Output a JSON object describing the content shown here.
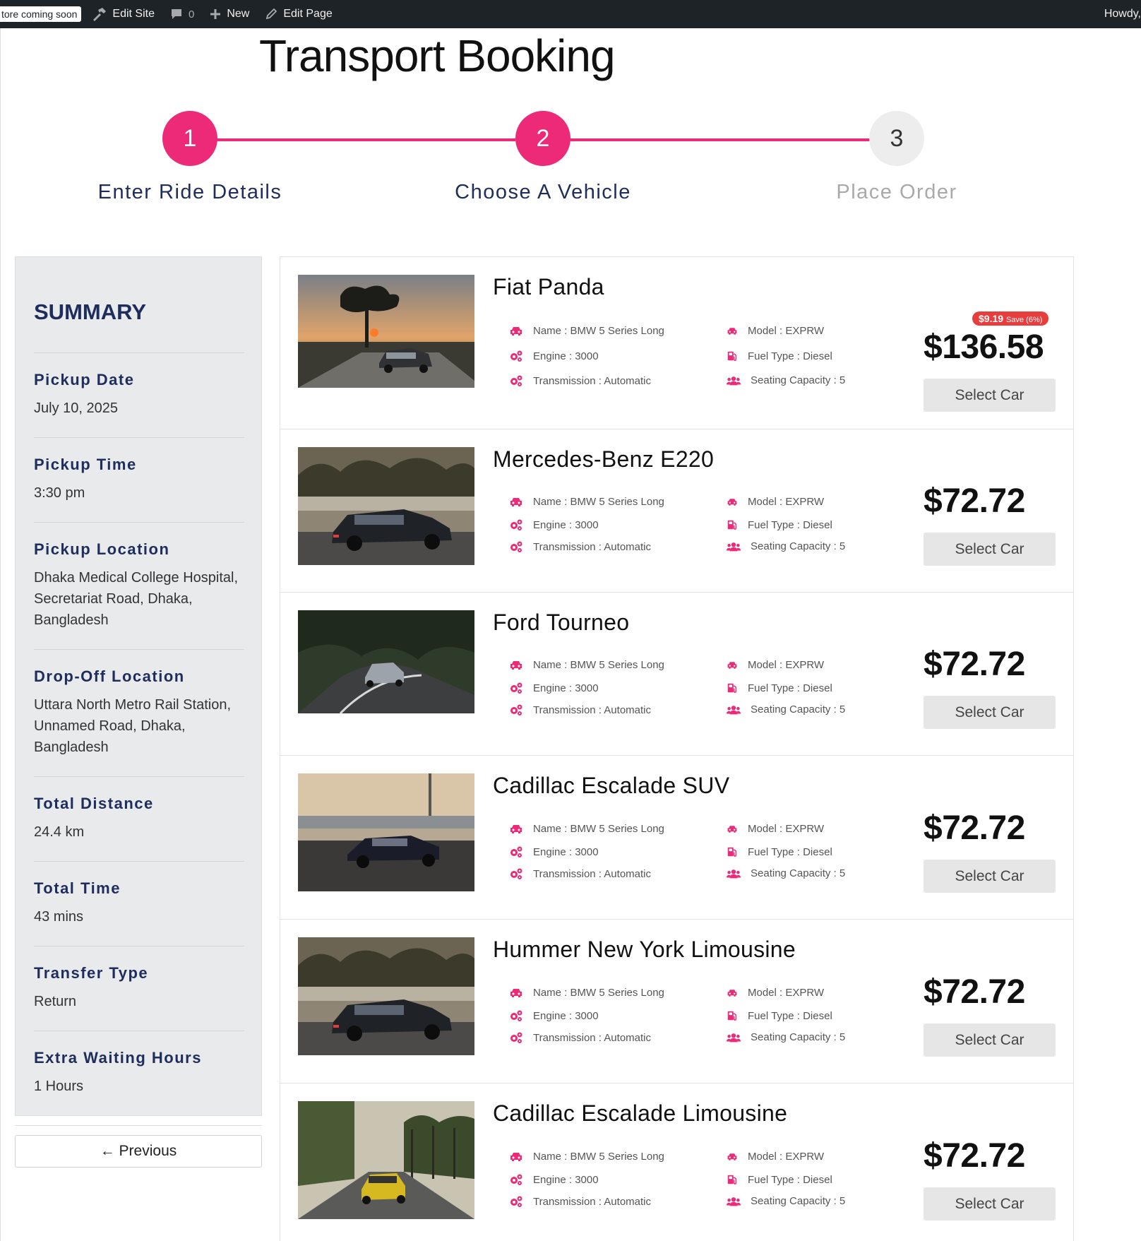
{
  "admin_bar": {
    "badge": "tore coming soon",
    "edit_site": "Edit Site",
    "comments_count": "0",
    "new": "New",
    "edit_page": "Edit Page",
    "howdy": "Howdy,"
  },
  "page": {
    "title": "Transport Booking"
  },
  "colors": {
    "accent": "#ec2a77",
    "navy": "#1e2d5c",
    "sale": "#e73d3d"
  },
  "steps": [
    {
      "number": "1",
      "label": "Enter Ride Details",
      "state": "active"
    },
    {
      "number": "2",
      "label": "Choose A Vehicle",
      "state": "active"
    },
    {
      "number": "3",
      "label": "Place Order",
      "state": "inactive"
    }
  ],
  "summary": {
    "title": "SUMMARY",
    "items": [
      {
        "label": "Pickup Date",
        "value": "July 10, 2025"
      },
      {
        "label": "Pickup Time",
        "value": "3:30 pm"
      },
      {
        "label": "Pickup Location",
        "value": "Dhaka Medical College Hospital, Secretariat Road, Dhaka, Bangladesh"
      },
      {
        "label": "Drop-Off Location",
        "value": "Uttara North Metro Rail Station, Unnamed Road, Dhaka, Bangladesh"
      },
      {
        "label": "Total Distance",
        "value": "24.4 km"
      },
      {
        "label": "Total Time",
        "value": "43 mins"
      },
      {
        "label": "Transfer Type",
        "value": "Return"
      },
      {
        "label": "Extra Waiting Hours",
        "value": "1 Hours"
      }
    ]
  },
  "previous_button": "← Previous",
  "vehicles": [
    {
      "name": "Fiat Panda",
      "price": "$136.58",
      "save_amount": "$9.19",
      "save_text": "Save (6%)",
      "specs_left": [
        "Name : BMW 5 Series Long",
        "Engine : 3000",
        "Transmission : Automatic"
      ],
      "specs_right": [
        "Model : EXPRW",
        "Fuel Type : Diesel",
        "Seating Capacity : 5"
      ],
      "button": "Select Car",
      "image": "sunset-tree-sedan"
    },
    {
      "name": "Mercedes-Benz E220",
      "price": "$72.72",
      "specs_left": [
        "Name : BMW 5 Series Long",
        "Engine : 3000",
        "Transmission : Automatic"
      ],
      "specs_right": [
        "Model : EXPRW",
        "Fuel Type : Diesel",
        "Seating Capacity : 5"
      ],
      "button": "Select Car",
      "image": "blurred-hatchback"
    },
    {
      "name": "Ford Tourneo",
      "price": "$72.72",
      "specs_left": [
        "Name : BMW 5 Series Long",
        "Engine : 3000",
        "Transmission : Automatic"
      ],
      "specs_right": [
        "Model : EXPRW",
        "Fuel Type : Diesel",
        "Seating Capacity : 5"
      ],
      "button": "Select Car",
      "image": "forest-road-coupe"
    },
    {
      "name": "Cadillac Escalade SUV",
      "price": "$72.72",
      "specs_left": [
        "Name : BMW 5 Series Long",
        "Engine : 3000",
        "Transmission : Automatic"
      ],
      "specs_right": [
        "Model : EXPRW",
        "Fuel Type : Diesel",
        "Seating Capacity : 5"
      ],
      "button": "Select Car",
      "image": "dark-sedan-bridge"
    },
    {
      "name": "Hummer New York Limousine",
      "price": "$72.72",
      "specs_left": [
        "Name : BMW 5 Series Long",
        "Engine : 3000",
        "Transmission : Automatic"
      ],
      "specs_right": [
        "Model : EXPRW",
        "Fuel Type : Diesel",
        "Seating Capacity : 5"
      ],
      "button": "Select Car",
      "image": "blurred-hatchback"
    },
    {
      "name": "Cadillac Escalade Limousine",
      "price": "$72.72",
      "specs_left": [
        "Name : BMW 5 Series Long",
        "Engine : 3000",
        "Transmission : Automatic"
      ],
      "specs_right": [
        "Model : EXPRW",
        "Fuel Type : Diesel",
        "Seating Capacity : 5"
      ],
      "button": "Select Car",
      "image": "yellow-car-road"
    }
  ],
  "spec_icons": {
    "left": [
      "car-icon",
      "cogs-icon",
      "cogs-icon"
    ],
    "right": [
      "car-icon",
      "fuel-pump-icon",
      "users-icon"
    ]
  }
}
